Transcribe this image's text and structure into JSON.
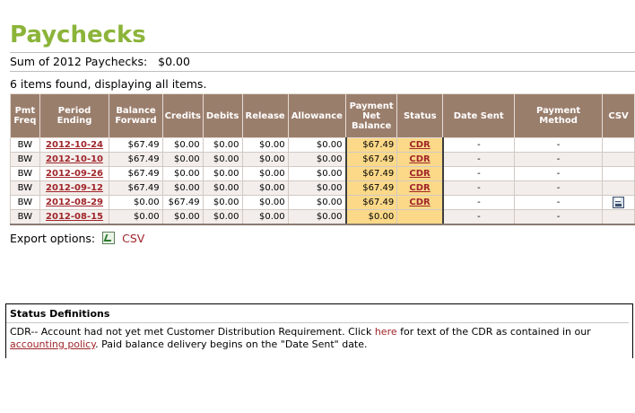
{
  "page": {
    "title": "Paychecks",
    "sum_label": "Sum of 2012 Paychecks:",
    "sum_value": "$0.00",
    "found_text": "6 items found, displaying all items."
  },
  "table": {
    "headers": {
      "pmt_freq": "Pmt Freq",
      "period_ending": "Period Ending",
      "balance_forward": "Balance Forward",
      "credits": "Credits",
      "debits": "Debits",
      "release": "Release",
      "allowance": "Allowance",
      "payment_net_balance": "Payment Net Balance",
      "status": "Status",
      "date_sent": "Date Sent",
      "payment_method": "Payment Method",
      "csv": "CSV"
    },
    "rows": [
      {
        "freq": "BW",
        "period": "2012-10-24",
        "balance_forward": "$67.49",
        "credits": "$0.00",
        "debits": "$0.00",
        "release": "$0.00",
        "allowance": "$0.00",
        "net": "$67.49",
        "status": "CDR",
        "date_sent": "-",
        "method": "-"
      },
      {
        "freq": "BW",
        "period": "2012-10-10",
        "balance_forward": "$67.49",
        "credits": "$0.00",
        "debits": "$0.00",
        "release": "$0.00",
        "allowance": "$0.00",
        "net": "$67.49",
        "status": "CDR",
        "date_sent": "-",
        "method": "-"
      },
      {
        "freq": "BW",
        "period": "2012-09-26",
        "balance_forward": "$67.49",
        "credits": "$0.00",
        "debits": "$0.00",
        "release": "$0.00",
        "allowance": "$0.00",
        "net": "$67.49",
        "status": "CDR",
        "date_sent": "-",
        "method": "-"
      },
      {
        "freq": "BW",
        "period": "2012-09-12",
        "balance_forward": "$67.49",
        "credits": "$0.00",
        "debits": "$0.00",
        "release": "$0.00",
        "allowance": "$0.00",
        "net": "$67.49",
        "status": "CDR",
        "date_sent": "-",
        "method": "-"
      },
      {
        "freq": "BW",
        "period": "2012-08-29",
        "balance_forward": "$0.00",
        "credits": "$67.49",
        "debits": "$0.00",
        "release": "$0.00",
        "allowance": "$0.00",
        "net": "$67.49",
        "status": "CDR",
        "date_sent": "-",
        "method": "-",
        "csv_icon": "save-icon"
      },
      {
        "freq": "BW",
        "period": "2012-08-15",
        "balance_forward": "$0.00",
        "credits": "$0.00",
        "debits": "$0.00",
        "release": "$0.00",
        "allowance": "$0.00",
        "net": "$0.00",
        "status": "",
        "date_sent": "-",
        "method": "-"
      }
    ]
  },
  "export": {
    "label": "Export options:",
    "csv_label": "CSV",
    "icon": "excel-icon"
  },
  "status_definitions": {
    "heading": "Status Definitions",
    "cdr_text_1": "CDR-- Account had not yet met Customer Distribution Requirement. Click",
    "here_link": "here",
    "cdr_text_2": "for text of the CDR as contained in our",
    "policy_link": "accounting policy",
    "cdr_text_3": ". Paid balance delivery begins on the \"Date Sent\" date."
  },
  "colors": {
    "title_green": "#8cb43a",
    "header_brown": "#9a7e6c",
    "highlight_yellow": "#fbd989",
    "link_red": "#a0252a"
  }
}
